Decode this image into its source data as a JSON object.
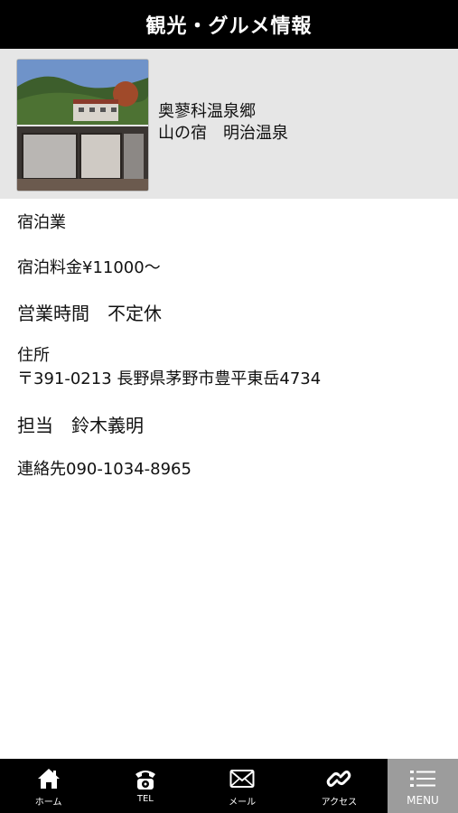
{
  "header": {
    "title": "観光・グルメ情報"
  },
  "hero": {
    "line1": "奥蓼科温泉郷",
    "line2": "山の宿　明治温泉"
  },
  "info": {
    "category": "宿泊業",
    "price": "宿泊料金¥11000～",
    "hours": "営業時間　不定休",
    "address_label": "住所",
    "address": "〒391-0213 長野県茅野市豊平東岳4734",
    "contact_person": "担当　鈴木義明",
    "phone": "連絡先090-1034-8965"
  },
  "tabbar": {
    "home": "ホーム",
    "tel": "TEL",
    "mail": "メール",
    "access": "アクセス",
    "menu": "MENU"
  },
  "colors": {
    "header_bg": "#000000",
    "hero_bg": "#e6e6e6",
    "tabbar_bg": "#000000",
    "menu_tab_bg": "#9c9c9c"
  },
  "icons": [
    "home-icon",
    "phone-icon",
    "mail-icon",
    "link-icon",
    "list-menu-icon"
  ]
}
